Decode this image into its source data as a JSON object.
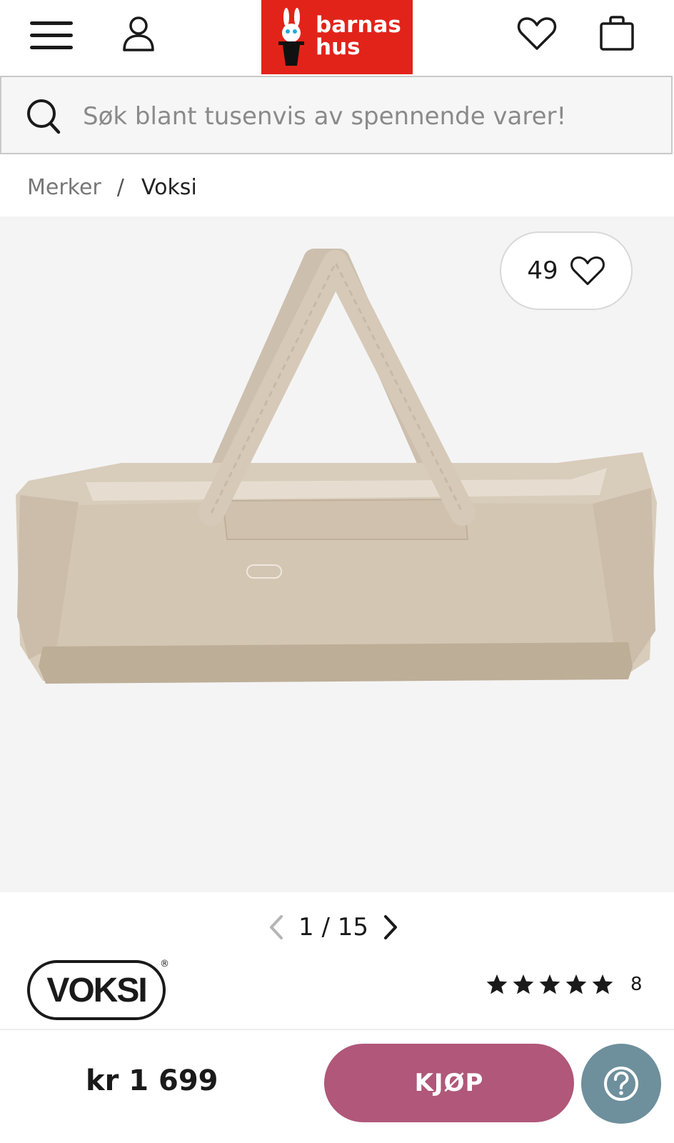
{
  "header": {
    "logo_line1": "barnas",
    "logo_line2": "hus",
    "icons": [
      "menu-icon",
      "account-icon",
      "heart-icon",
      "shopping-bag-icon"
    ],
    "brand_color": "#e2231a"
  },
  "search": {
    "placeholder": "Søk blant tusenvis av spennende varer!"
  },
  "breadcrumb": {
    "items": [
      "Merker",
      "Voksi"
    ],
    "separator": "/"
  },
  "gallery": {
    "favorites_count": "49",
    "current": "1",
    "separator": "/",
    "total": "15"
  },
  "product": {
    "brand_logo": "VOKSI",
    "brand_reg": "®",
    "rating_stars": 5,
    "rating_count": "8",
    "price": "kr 1 699",
    "buy_label": "KJØP",
    "buy_color": "#b0577a",
    "help_color": "#6e8f9c"
  }
}
